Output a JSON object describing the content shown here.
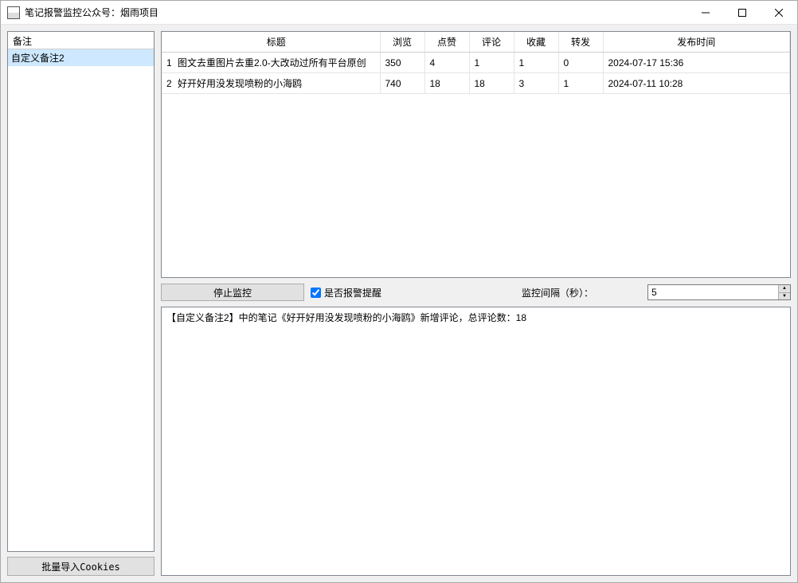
{
  "window": {
    "title": "笔记报警监控公众号：烟雨项目"
  },
  "sidebar": {
    "header": "备注",
    "items": [
      {
        "label": "自定义备注2",
        "selected": true
      }
    ]
  },
  "bulk_import_label": "批量导入Cookies",
  "table": {
    "headers": {
      "title": "标题",
      "views": "浏览",
      "likes": "点赞",
      "comments": "评论",
      "favs": "收藏",
      "shares": "转发",
      "time": "发布时间"
    },
    "rows": [
      {
        "idx": "1",
        "title": "图文去重图片去重2.0-大改动过所有平台原创",
        "views": "350",
        "likes": "4",
        "comments": "1",
        "favs": "1",
        "shares": "0",
        "time": "2024-07-17 15:36"
      },
      {
        "idx": "2",
        "title": "好开好用没发现喷粉的小海鸥",
        "views": "740",
        "likes": "18",
        "comments": "18",
        "favs": "3",
        "shares": "1",
        "time": "2024-07-11 10:28"
      }
    ]
  },
  "controls": {
    "stop_label": "停止监控",
    "alarm_label": "是否报警提醒",
    "alarm_checked": true,
    "interval_label": "监控间隔（秒）：",
    "interval_value": "5"
  },
  "log": {
    "lines": [
      "【自定义备注2】中的笔记《好开好用没发现喷粉的小海鸥》新增评论，总评论数：18"
    ]
  }
}
